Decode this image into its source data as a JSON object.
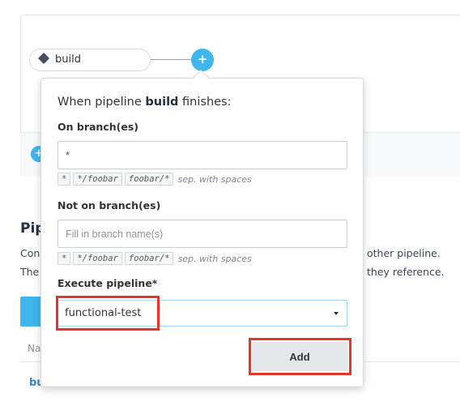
{
  "canvas": {
    "node_label": "build",
    "add_node_symbol": "+",
    "add_small_symbol": "+"
  },
  "background": {
    "heading": "Pip",
    "line1_start": "Con",
    "line2_start": "The",
    "line1_end": "other pipeline.",
    "line2_end": "they reference.",
    "column_header": "Na",
    "row_link": "bu"
  },
  "popover": {
    "title_prefix": "When pipeline",
    "title_pipeline": "build",
    "title_suffix": "finishes:",
    "on_branches": {
      "label": "On branch(es)",
      "value": "*",
      "chips": [
        "*",
        "*/foobar",
        "foobar/*"
      ],
      "hint": "sep. with spaces"
    },
    "not_on_branches": {
      "label": "Not on branch(es)",
      "placeholder": "Fill in branch name(s)",
      "chips": [
        "*",
        "*/foobar",
        "foobar/*"
      ],
      "hint": "sep. with spaces"
    },
    "execute": {
      "label": "Execute pipeline*",
      "selected": "functional-test"
    },
    "add_label": "Add"
  },
  "colors": {
    "accent": "#3fb6ec",
    "highlight": "#e53527"
  },
  "icons": {
    "node": "diamond-icon",
    "add": "plus-icon",
    "select": "caret-down-icon"
  }
}
